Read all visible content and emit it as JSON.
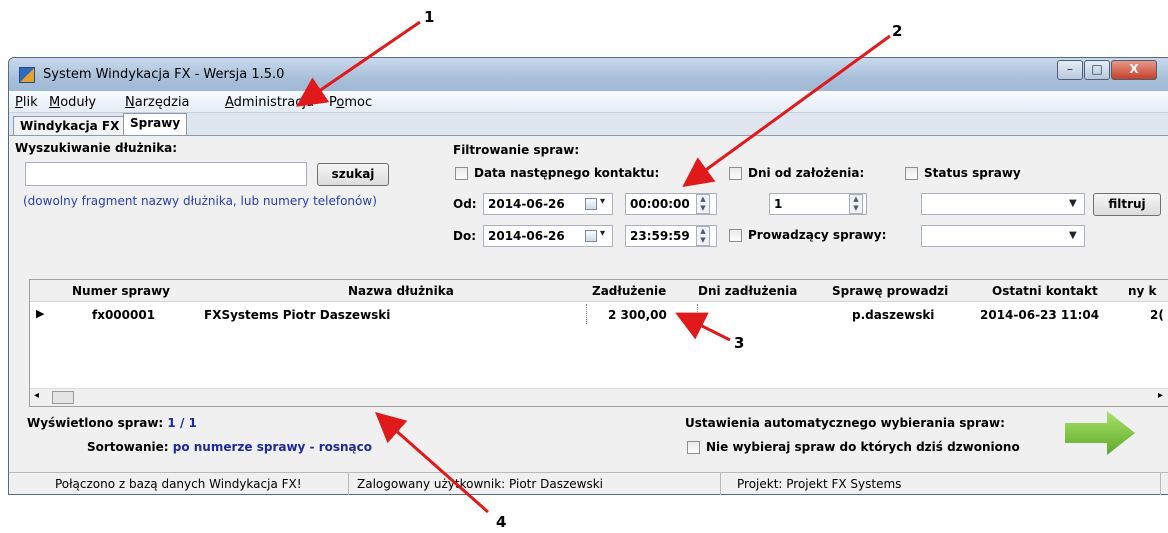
{
  "window": {
    "title": "System Windykacja FX - Wersja 1.5.0",
    "controls": {
      "minimize": "–",
      "maximize": "□",
      "close": "X"
    }
  },
  "menu": {
    "items": [
      {
        "pre": "",
        "u": "P",
        "post": "lik"
      },
      {
        "pre": "",
        "u": "M",
        "post": "oduły"
      },
      {
        "pre": "",
        "u": "N",
        "post": "arzędzia"
      },
      {
        "pre": "",
        "u": "A",
        "post": "dministracja"
      },
      {
        "pre": "P",
        "u": "o",
        "post": "moc"
      }
    ]
  },
  "tabs": {
    "t1": "Windykacja FX",
    "t2": "Sprawy"
  },
  "search": {
    "label": "Wyszukiwanie dłużnika:",
    "value": "",
    "button": "szukaj",
    "hint": "(dowolny fragment nazwy dłużnika, lub numery telefonów)"
  },
  "filter": {
    "label": "Filtrowanie spraw:",
    "next_contact": "Data następnego kontaktu:",
    "days_since": "Dni od założenia:",
    "status": "Status sprawy",
    "from_label": "Od:",
    "to_label": "Do:",
    "from_date": "2014-06-26",
    "from_time": "00:00:00",
    "to_date": "2014-06-26",
    "to_time": "23:59:59",
    "days_value": "1",
    "handler_label": "Prowadzący sprawy:",
    "status_value": "",
    "handler_value": "",
    "button": "filtruj"
  },
  "grid": {
    "columns": [
      "Numer sprawy",
      "Nazwa dłużnika",
      "Zadłużenie",
      "Dni zadłużenia",
      "Sprawę prowadzi",
      "Ostatni kontakt",
      "ny k"
    ],
    "rows": [
      {
        "nr": "fx000001",
        "name": "FXSystems Piotr Daszewski",
        "debt": "2 300,00",
        "days": "",
        "handler": "p.daszewski",
        "last": "2014-06-23 11:04",
        "extra": "2("
      }
    ]
  },
  "summary": {
    "shown_label": "Wyświetlono spraw:",
    "shown_value": "1 / 1",
    "sort_label": "Sortowanie:",
    "sort_value": "po numerze sprawy - rosnąco",
    "auto_label": "Ustawienia automatycznego wybierania spraw:",
    "auto_option": "Nie wybieraj spraw do których dziś dzwoniono"
  },
  "status": {
    "db": "Połączono z bazą danych Windykacja FX!",
    "user": "Zalogowany użytkownik: Piotr Daszewski",
    "project": "Projekt: Projekt FX Systems"
  },
  "annotations": {
    "a1": "1",
    "a2": "2",
    "a3": "3",
    "a4": "4"
  },
  "colors": {
    "arrow": "#e01a1a",
    "next_arrow": "#7cc63a",
    "link_blue": "#1c2a9c"
  }
}
